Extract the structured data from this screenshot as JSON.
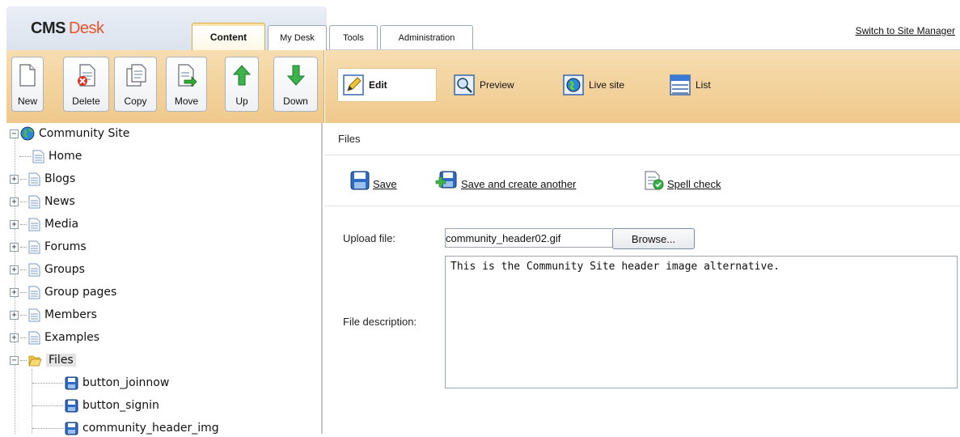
{
  "header": {
    "logo_cms": "CMS",
    "logo_desk": "Desk",
    "tabs": [
      {
        "label": "Content",
        "active": true
      },
      {
        "label": "My Desk"
      },
      {
        "label": "Tools"
      },
      {
        "label": "Administration"
      }
    ],
    "switch_link": "Switch to Site Manager"
  },
  "toolbar": {
    "buttons": [
      "New",
      "Delete",
      "Copy",
      "Move",
      "Up",
      "Down"
    ],
    "icons": [
      "page-icon",
      "delete-page-icon",
      "copy-icon",
      "move-icon",
      "arrow-up-icon",
      "arrow-down-icon"
    ]
  },
  "view_modes": [
    {
      "label": "Edit",
      "icon": "pencil-icon",
      "active": true
    },
    {
      "label": "Preview",
      "icon": "magnifier-icon"
    },
    {
      "label": "Live site",
      "icon": "globe-icon"
    },
    {
      "label": "List",
      "icon": "list-icon"
    }
  ],
  "tree": {
    "root": "Community Site",
    "items": [
      "Home",
      "Blogs",
      "News",
      "Media",
      "Forums",
      "Groups",
      "Group pages",
      "Members",
      "Examples",
      "Files"
    ],
    "children": [
      "button_joinnow",
      "button_signin",
      "community_header_img"
    ]
  },
  "content": {
    "title": "Files",
    "actions": {
      "save": "Save",
      "save_another": "Save and create another",
      "spell_check": "Spell check"
    },
    "upload_label": "Upload file:",
    "upload_value": "community_header02.gif",
    "browse": "Browse...",
    "description_label": "File description:",
    "description_value": "This is the Community Site header image alternative."
  },
  "colors": {
    "toolbar": "#efc98c",
    "accent_desk": "#e4542b"
  }
}
